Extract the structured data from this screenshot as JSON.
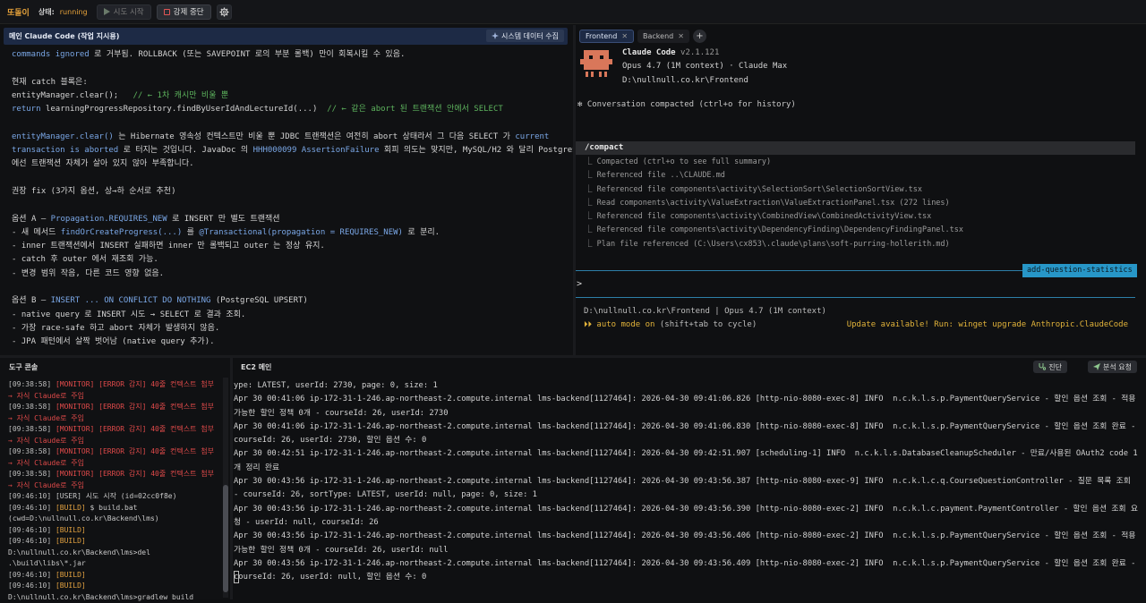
{
  "topbar": {
    "app_name": "또돌이",
    "status_label": "상태:",
    "status_value": "running",
    "start_label": "시도 시작",
    "stop_label": "강제 중단",
    "gear_icon": "gear-icon",
    "play_icon": "play-icon"
  },
  "main_panel": {
    "title": "메인 Claude Code (작업 지시용)",
    "collect_label": "시스템 데이터 수집",
    "lines": [
      {
        "segs": [
          {
            "t": "commands ignored",
            "c": "k"
          },
          {
            "t": " 로 거부됨. ROLLBACK (또는 SAVEPOINT 로의 부분 롤백) 만이 회복시킬 수 있음."
          }
        ]
      },
      {
        "segs": [
          {
            "t": ""
          }
        ]
      },
      {
        "segs": [
          {
            "t": "현재 catch 블록은:"
          }
        ]
      },
      {
        "segs": [
          {
            "t": "entityManager.clear();   "
          },
          {
            "t": "// ← 1차 캐시만 비울 뿐",
            "c": "cm"
          }
        ]
      },
      {
        "segs": [
          {
            "t": "return",
            "c": "k"
          },
          {
            "t": " learningProgressRepository.findByUserIdAndLectureId(...)  "
          },
          {
            "t": "// ← 같은 abort 된 트랜잭션 안에서 SELECT",
            "c": "cm"
          }
        ]
      },
      {
        "segs": [
          {
            "t": ""
          }
        ]
      },
      {
        "segs": [
          {
            "t": "entityManager.clear()",
            "c": "k"
          },
          {
            "t": " 는 Hibernate 영속성 컨텍스트만 비울 뿐 JDBC 트랜잭션은 여전히 abort 상태라서 그 다음 SELECT 가 "
          },
          {
            "t": "current",
            "c": "k"
          }
        ]
      },
      {
        "segs": [
          {
            "t": "transaction is aborted",
            "c": "k"
          },
          {
            "t": " 로 터지는 것입니다. JavaDoc 의 "
          },
          {
            "t": "HHH000099 AssertionFailure",
            "c": "k"
          },
          {
            "t": " 회피 의도는 맞지만, MySQL/H2 와 달리 PostgreSQL"
          }
        ]
      },
      {
        "segs": [
          {
            "t": "에선 트랜잭션 자체가 살아 있지 않아 부족합니다."
          }
        ]
      },
      {
        "segs": [
          {
            "t": ""
          }
        ]
      },
      {
        "segs": [
          {
            "t": "권장 fix (3가지 옵션, 상→하 순서로 추천)"
          }
        ]
      },
      {
        "segs": [
          {
            "t": ""
          }
        ]
      },
      {
        "segs": [
          {
            "t": "옵션 A — "
          },
          {
            "t": "Propagation.REQUIRES_NEW",
            "c": "k"
          },
          {
            "t": " 로 INSERT 만 별도 트랜잭션"
          }
        ]
      },
      {
        "segs": [
          {
            "t": "- 새 메서드 "
          },
          {
            "t": "findOrCreateProgress(...)",
            "c": "k"
          },
          {
            "t": " 를 "
          },
          {
            "t": "@Transactional(propagation = REQUIRES_NEW)",
            "c": "k"
          },
          {
            "t": " 로 분리."
          }
        ]
      },
      {
        "segs": [
          {
            "t": "- inner 트랜잭션에서 INSERT 실패하면 inner 만 롤백되고 outer 는 정상 유지."
          }
        ]
      },
      {
        "segs": [
          {
            "t": "- catch 후 outer 에서 재조회 가능."
          }
        ]
      },
      {
        "segs": [
          {
            "t": "- 변경 범위 작음, 다른 코드 영향 없음."
          }
        ]
      },
      {
        "segs": [
          {
            "t": ""
          }
        ]
      },
      {
        "segs": [
          {
            "t": "옵션 B — "
          },
          {
            "t": "INSERT ... ON CONFLICT DO NOTHING",
            "c": "k"
          },
          {
            "t": " (PostgreSQL UPSERT)"
          }
        ]
      },
      {
        "segs": [
          {
            "t": "- native query 로 INSERT 시도 → SELECT 로 결과 조회."
          }
        ]
      },
      {
        "segs": [
          {
            "t": "- 가장 race-safe 하고 abort 자체가 발생하지 않음."
          }
        ]
      },
      {
        "segs": [
          {
            "t": "- JPA 패턴에서 살짝 벗어남 (native query 추가)."
          }
        ]
      }
    ]
  },
  "right_panel": {
    "tabs": [
      {
        "label": "Frontend",
        "active": true
      },
      {
        "label": "Backend",
        "active": false
      }
    ],
    "cc_name": "Claude Code",
    "cc_version": "v2.1.121",
    "model": "Opus 4.7 (1M context) · Claude Max",
    "cwd": "D:\\nullnull.co.kr\\Frontend",
    "compacted": "✻ Conversation compacted (ctrl+o for history)",
    "command": "/compact",
    "compact_items": [
      "⎿ Compacted (ctrl+o to see full summary)",
      "⎿ Referenced file ..\\CLAUDE.md",
      "⎿ Referenced file components\\activity\\SelectionSort\\SelectionSortView.tsx",
      "⎿ Read components\\activity\\ValueExtraction\\ValueExtractionPanel.tsx (272 lines)",
      "⎿ Referenced file components\\activity\\CombinedView\\CombinedActivityView.tsx",
      "⎿ Referenced file components\\activity\\DependencyFinding\\DependencyFindingPanel.tsx",
      "⎿ Plan file referenced (C:\\Users\\cx853\\.claude\\plans\\soft-purring-hollerith.md)"
    ],
    "branch": "add-question-statistics",
    "prompt": ">",
    "footer_path": "D:\\nullnull.co.kr\\Frontend | Opus 4.7 (1M context)",
    "auto_mode": "⏵⏵ auto mode on",
    "auto_hint": " (shift+tab to cycle)",
    "update_notice": "Update available! Run: winget upgrade Anthropic.ClaudeCode"
  },
  "tools_panel": {
    "title": "도구 콘솔",
    "log": [
      {
        "ts": "[09:38:58]",
        "tag": "[MONITOR]",
        "c": "mon",
        "msg": " [ERROR 감지] 40줄 컨텍스트 첨부 → 자식 Claude로 주입"
      },
      {
        "ts": "[09:38:58]",
        "tag": "[MONITOR]",
        "c": "mon",
        "msg": " [ERROR 감지] 40줄 컨텍스트 첨부 → 자식 Claude로 주입"
      },
      {
        "ts": "[09:38:58]",
        "tag": "[MONITOR]",
        "c": "mon",
        "msg": " [ERROR 감지] 40줄 컨텍스트 첨부 → 자식 Claude로 주입"
      },
      {
        "ts": "[09:38:58]",
        "tag": "[MONITOR]",
        "c": "mon",
        "msg": " [ERROR 감지] 40줄 컨텍스트 첨부 → 자식 Claude로 주입"
      },
      {
        "ts": "[09:38:58]",
        "tag": "[MONITOR]",
        "c": "mon",
        "msg": " [ERROR 감지] 40줄 컨텍스트 첨부 → 자식 Claude로 주입"
      },
      {
        "ts": "[09:46:10]",
        "tag": "[USER]",
        "c": "",
        "msg": " 시도 시작 (id=02cc0f8e)"
      },
      {
        "ts": "[09:46:10]",
        "tag": "[BUILD]",
        "c": "build",
        "msg": " $ build.bat (cwd=D:\\nullnull.co.kr\\Backend\\lms)"
      },
      {
        "ts": "[09:46:10]",
        "tag": "[BUILD]",
        "c": "build",
        "msg": ""
      },
      {
        "ts": "[09:46:10]",
        "tag": "[BUILD]",
        "c": "build",
        "msg": " D:\\nullnull.co.kr\\Backend\\lms>del .\\build\\libs\\*.jar"
      },
      {
        "ts": "[09:46:10]",
        "tag": "[BUILD]",
        "c": "build",
        "msg": ""
      },
      {
        "ts": "[09:46:10]",
        "tag": "[BUILD]",
        "c": "build",
        "msg": " D:\\nullnull.co.kr\\Backend\\lms>gradlew build"
      }
    ]
  },
  "ec2_panel": {
    "title": "EC2 메인",
    "diag_label": "진단",
    "analyze_label": "분석 요청",
    "log": [
      "ype: LATEST, userId: 2730, page: 0, size: 1",
      "Apr 30 00:41:06 ip-172-31-1-246.ap-northeast-2.compute.internal lms-backend[1127464]: 2026-04-30 09:41:06.826 [http-nio-8080-exec-8] INFO  n.c.k.l.s.p.PaymentQueryService - 할인 옵션 조회 - 적용 가능한 할인 정책 0개 - courseId: 26, userId: 2730",
      "Apr 30 00:41:06 ip-172-31-1-246.ap-northeast-2.compute.internal lms-backend[1127464]: 2026-04-30 09:41:06.830 [http-nio-8080-exec-8] INFO  n.c.k.l.s.p.PaymentQueryService - 할인 옵션 조회 완료 - courseId: 26, userId: 2730, 할인 옵션 수: 0",
      "Apr 30 00:42:51 ip-172-31-1-246.ap-northeast-2.compute.internal lms-backend[1127464]: 2026-04-30 09:42:51.907 [scheduling-1] INFO  n.c.k.l.s.DatabaseCleanupScheduler - 만료/사용된 OAuth2 code 1개 정리 완료",
      "Apr 30 00:43:56 ip-172-31-1-246.ap-northeast-2.compute.internal lms-backend[1127464]: 2026-04-30 09:43:56.387 [http-nio-8080-exec-9] INFO  n.c.k.l.c.q.CourseQuestionController - 질문 목록 조회 - courseId: 26, sortType: LATEST, userId: null, page: 0, size: 1",
      "Apr 30 00:43:56 ip-172-31-1-246.ap-northeast-2.compute.internal lms-backend[1127464]: 2026-04-30 09:43:56.390 [http-nio-8080-exec-2] INFO  n.c.k.l.c.payment.PaymentController - 할인 옵션 조회 요청 - userId: null, courseId: 26",
      "Apr 30 00:43:56 ip-172-31-1-246.ap-northeast-2.compute.internal lms-backend[1127464]: 2026-04-30 09:43:56.406 [http-nio-8080-exec-2] INFO  n.c.k.l.s.p.PaymentQueryService - 할인 옵션 조회 - 적용 가능한 할인 정책 0개 - courseId: 26, userId: null",
      "Apr 30 00:43:56 ip-172-31-1-246.ap-northeast-2.compute.internal lms-backend[1127464]: 2026-04-30 09:43:56.409 [http-nio-8080-exec-2] INFO  n.c.k.l.s.p.PaymentQueryService - 할인 옵션 조회 완료 - courseId: 26, userId: null, 할인 옵션 수: 0"
    ]
  }
}
